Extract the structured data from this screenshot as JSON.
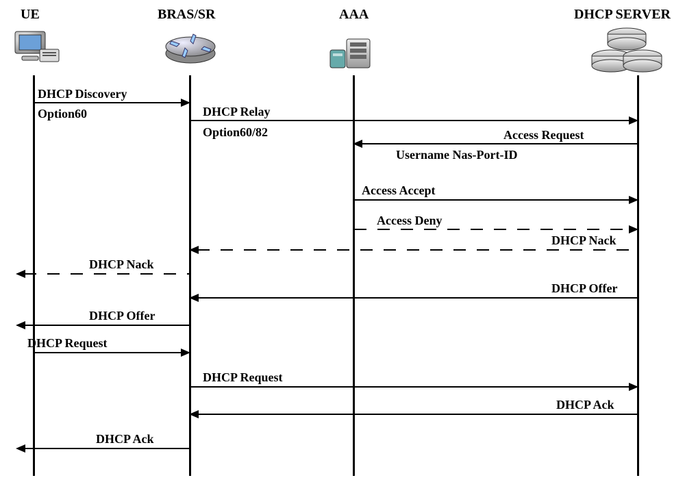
{
  "participants": {
    "ue": "UE",
    "bras": "BRAS/SR",
    "aaa": "AAA",
    "dhcp": "DHCP SERVER"
  },
  "icons": {
    "ue": "workstation-icon",
    "bras": "router-icon",
    "aaa": "server-icon",
    "dhcp": "database-cluster-icon"
  },
  "messages": {
    "discovery": "DHCP Discovery",
    "option60": "Option60",
    "relay": "DHCP Relay",
    "option6082": "Option60/82",
    "accessRequest": "Access Request",
    "usernameNas": "Username Nas-Port-ID",
    "accessAccept": "Access Accept",
    "accessDeny": "Access Deny",
    "dhcpNack1": "DHCP Nack",
    "dhcpNack2": "DHCP Nack",
    "dhcpOffer1": "DHCP Offer",
    "dhcpOffer2": "DHCP Offer",
    "dhcpRequest1": "DHCP Request",
    "dhcpRequest2": "DHCP Request",
    "dhcpAck1": "DHCP Ack",
    "dhcpAck2": "DHCP Ack"
  },
  "chart_data": {
    "type": "sequence-diagram",
    "participants": [
      "UE",
      "BRAS/SR",
      "AAA",
      "DHCP SERVER"
    ],
    "messages": [
      {
        "from": "UE",
        "to": "BRAS/SR",
        "label": "DHCP Discovery",
        "note_below": "Option60",
        "style": "solid"
      },
      {
        "from": "BRAS/SR",
        "to": "DHCP SERVER",
        "label": "DHCP Relay",
        "note_below": "Option60/82",
        "style": "solid"
      },
      {
        "from": "DHCP SERVER",
        "to": "AAA",
        "label": "Access Request",
        "note_below": "Username Nas-Port-ID",
        "style": "solid"
      },
      {
        "from": "AAA",
        "to": "DHCP SERVER",
        "label": "Access Accept",
        "style": "solid"
      },
      {
        "from": "AAA",
        "to": "DHCP SERVER",
        "label": "Access Deny",
        "style": "dashed"
      },
      {
        "from": "DHCP SERVER",
        "to": "BRAS/SR",
        "label": "DHCP Nack",
        "style": "dashed"
      },
      {
        "from": "BRAS/SR",
        "to": "UE",
        "label": "DHCP Nack",
        "style": "dashed"
      },
      {
        "from": "DHCP SERVER",
        "to": "BRAS/SR",
        "label": "DHCP Offer",
        "style": "solid"
      },
      {
        "from": "BRAS/SR",
        "to": "UE",
        "label": "DHCP Offer",
        "style": "solid"
      },
      {
        "from": "UE",
        "to": "BRAS/SR",
        "label": "DHCP Request",
        "style": "solid"
      },
      {
        "from": "BRAS/SR",
        "to": "DHCP SERVER",
        "label": "DHCP Request",
        "style": "solid"
      },
      {
        "from": "DHCP SERVER",
        "to": "BRAS/SR",
        "label": "DHCP Ack",
        "style": "solid"
      },
      {
        "from": "BRAS/SR",
        "to": "UE",
        "label": "DHCP Ack",
        "style": "solid"
      }
    ]
  }
}
